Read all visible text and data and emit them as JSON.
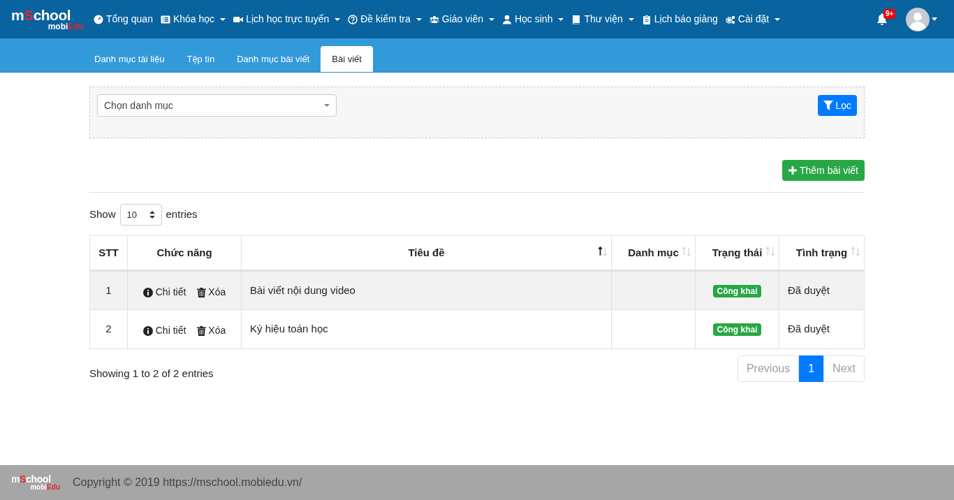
{
  "logo": {
    "segments": [
      {
        "text": "m",
        "color": "#ffffff"
      },
      {
        "text": "S",
        "color": "#e3262e"
      },
      {
        "text": "chool",
        "color": "#ffffff"
      }
    ],
    "sub": [
      {
        "text": "mobi",
        "color": "#ffffff"
      },
      {
        "text": "Edu",
        "color": "#e3262e"
      }
    ]
  },
  "nav": [
    {
      "label": "Tổng quan",
      "kind": "gauge",
      "dropdown": false
    },
    {
      "label": "Khóa học",
      "kind": "list",
      "dropdown": true
    },
    {
      "label": "Lịch học trực tuyến",
      "kind": "video",
      "dropdown": true
    },
    {
      "label": "Đề kiểm tra",
      "kind": "question",
      "dropdown": true
    },
    {
      "label": "Giáo viên",
      "kind": "users",
      "dropdown": true
    },
    {
      "label": "Học sinh",
      "kind": "user",
      "dropdown": true
    },
    {
      "label": "Thư viện",
      "kind": "book",
      "dropdown": true
    },
    {
      "label": "Lịch báo giảng",
      "kind": "clipboard",
      "dropdown": false
    },
    {
      "label": "Cài đặt",
      "kind": "gears",
      "dropdown": true
    }
  ],
  "notifications": {
    "badge": "9+"
  },
  "tabs": [
    {
      "label": "Danh mục tài liệu",
      "selected": false
    },
    {
      "label": "Tệp tin",
      "selected": false
    },
    {
      "label": "Danh mục bài viết",
      "selected": false
    },
    {
      "label": "Bài viết",
      "selected": true
    }
  ],
  "filter": {
    "select": "Chọn danh mục",
    "button": "Lọc"
  },
  "add_button": "Thêm bài viết",
  "length": {
    "show": "Show",
    "value": "10",
    "entries": "entries"
  },
  "table": {
    "columns": [
      {
        "label": "STT",
        "sortable": false
      },
      {
        "label": "Chức năng",
        "sortable": false
      },
      {
        "label": "Tiêu đề",
        "sortable": true,
        "sorted": true
      },
      {
        "label": "Danh mục",
        "sortable": true,
        "sorted": false
      },
      {
        "label": "Trạng thái",
        "sortable": true,
        "sorted": false
      },
      {
        "label": "Tình trạng",
        "sortable": true,
        "sorted": false
      }
    ],
    "rows": [
      {
        "stt": "1",
        "detail": "Chi tiết",
        "delete": "Xóa",
        "title": "Bài viết nội dung video",
        "category": "",
        "badge": "Công khai",
        "state": "Đã duyệt"
      },
      {
        "stt": "2",
        "detail": "Chi tiết",
        "delete": "Xóa",
        "title": "Ký hiệu toán học",
        "category": "",
        "badge": "Công khai",
        "state": "Đã duyệt"
      }
    ]
  },
  "info": "Showing 1 to 2 of 2 entries",
  "pagination": [
    {
      "label": "Previous",
      "selected": false
    },
    {
      "label": "1",
      "selected": true
    },
    {
      "label": "Next",
      "selected": false
    }
  ],
  "footer": {
    "logo": {
      "segments": [
        {
          "text": "m",
          "color": "#ffffff"
        },
        {
          "text": "S",
          "color": "#e3262e"
        },
        {
          "text": "chool",
          "color": "#ffffff"
        }
      ],
      "sub": [
        {
          "text": "mobi",
          "color": "#ffffff"
        },
        {
          "text": "Edu",
          "color": "#e3262e"
        }
      ]
    },
    "copyright": "Copyright © 2019 https://mschool.mobiedu.vn/"
  }
}
